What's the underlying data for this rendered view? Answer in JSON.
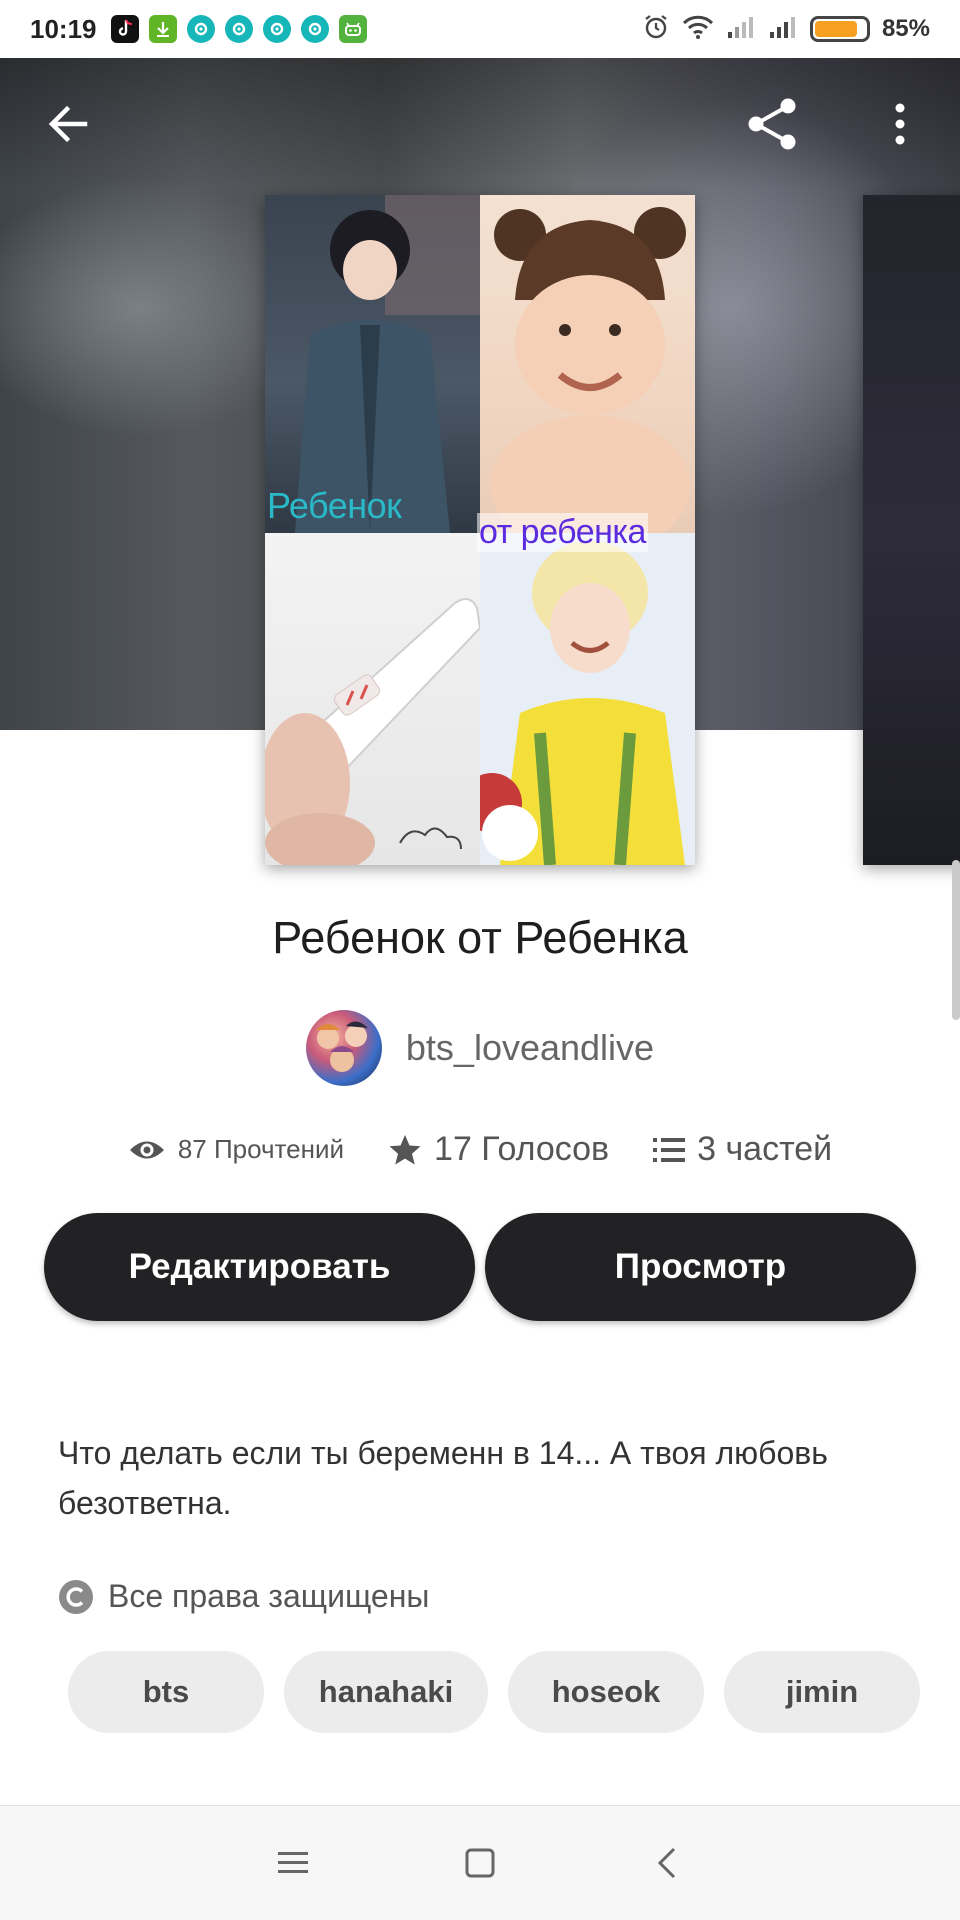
{
  "status_bar": {
    "time": "10:19",
    "battery_percent": "85%",
    "battery_level": 0.85,
    "notification_icons": [
      "tiktok-icon",
      "download-icon",
      "app-icon",
      "app-icon",
      "app-icon",
      "app-icon",
      "android-icon"
    ],
    "system_icons": [
      "alarm-icon",
      "wifi-icon",
      "signal-icon",
      "signal-icon",
      "battery-icon"
    ]
  },
  "toolbar": {
    "back_icon": "back-arrow-icon",
    "share_icon": "share-icon",
    "more_icon": "more-vertical-icon"
  },
  "cover": {
    "caption_top_left": "Ребенок",
    "caption_top_right": "от ребенка"
  },
  "story": {
    "title": "Ребенок от Ребенка",
    "author": "bts_loveandlive",
    "stats": {
      "reads": "87 Прочтений",
      "votes": "17 Голосов",
      "parts": "3 частей"
    },
    "description": "Что делать если ты беременн в 14... А твоя любовь безответна.",
    "rights": "Все права защищены"
  },
  "actions": {
    "edit_label": "Редактировать",
    "view_label": "Просмотр"
  },
  "tags": [
    "bts",
    "hanahaki",
    "hoseok",
    "jimin"
  ],
  "colors": {
    "button_bg": "#222124",
    "tag_bg": "#ececec",
    "battery_fill": "#f5a020",
    "cover_caption_1": "#2ab9c7",
    "cover_caption_2": "#5b2be0"
  }
}
